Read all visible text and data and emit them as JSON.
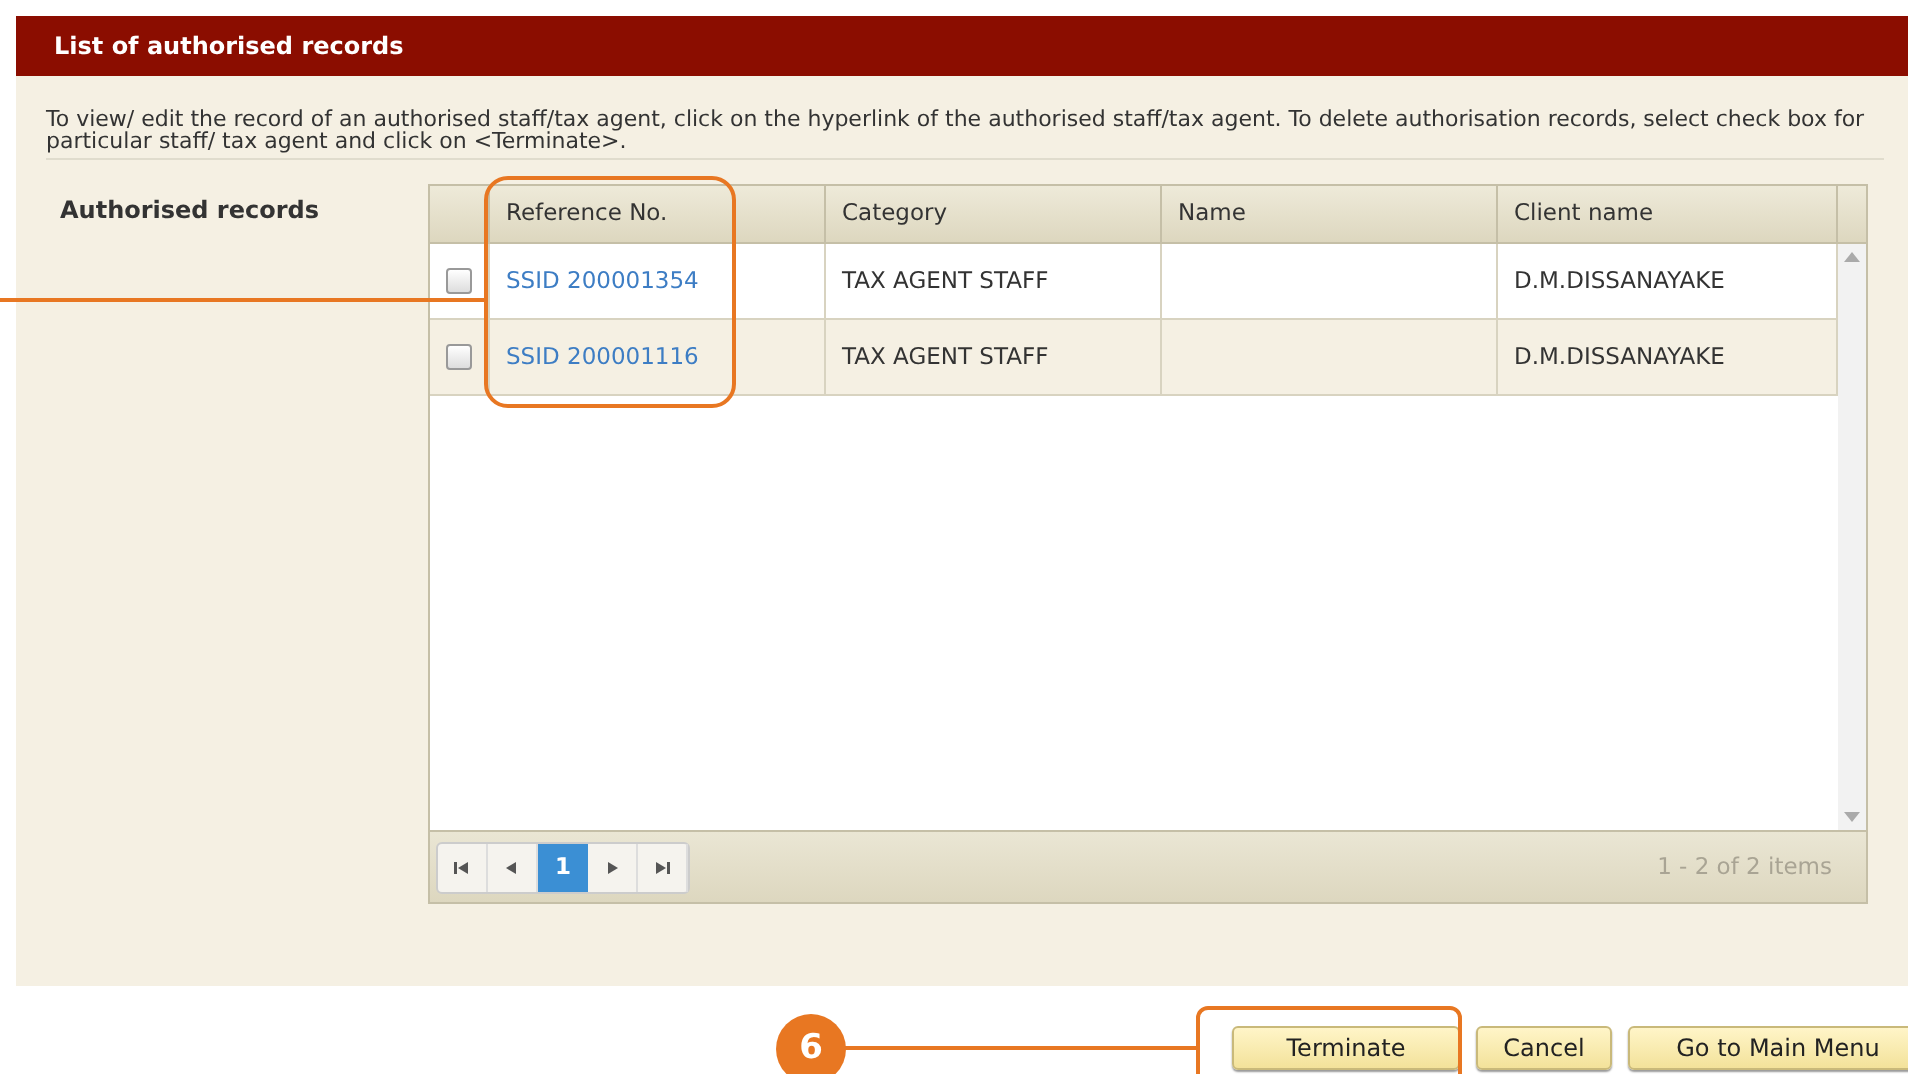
{
  "header": {
    "title": "List of authorised records"
  },
  "instructions": "To view/ edit the record of an authorised staff/tax agent, click on the hyperlink of the authorised staff/tax agent. To delete authorisation records, select check box for particular staff/ tax agent and click on <Terminate>.",
  "section_label": "Authorised records",
  "table": {
    "columns": [
      "Reference No.",
      "Category",
      "Name",
      "Client name"
    ],
    "rows": [
      {
        "checked": false,
        "reference": "SSID 200001354",
        "category": "TAX AGENT STAFF",
        "client_name": "D.M.DISSANAYAKE"
      },
      {
        "checked": false,
        "reference": "SSID 200001116",
        "category": "TAX AGENT STAFF",
        "client_name": "D.M.DISSANAYAKE"
      }
    ]
  },
  "pager": {
    "pages": [
      {
        "label": "1",
        "selected": true
      }
    ],
    "summary": "1 - 2 of 2 items"
  },
  "buttons": [
    "Terminate",
    "Cancel",
    "Go to Main Menu"
  ],
  "callout": {
    "number": "6"
  }
}
